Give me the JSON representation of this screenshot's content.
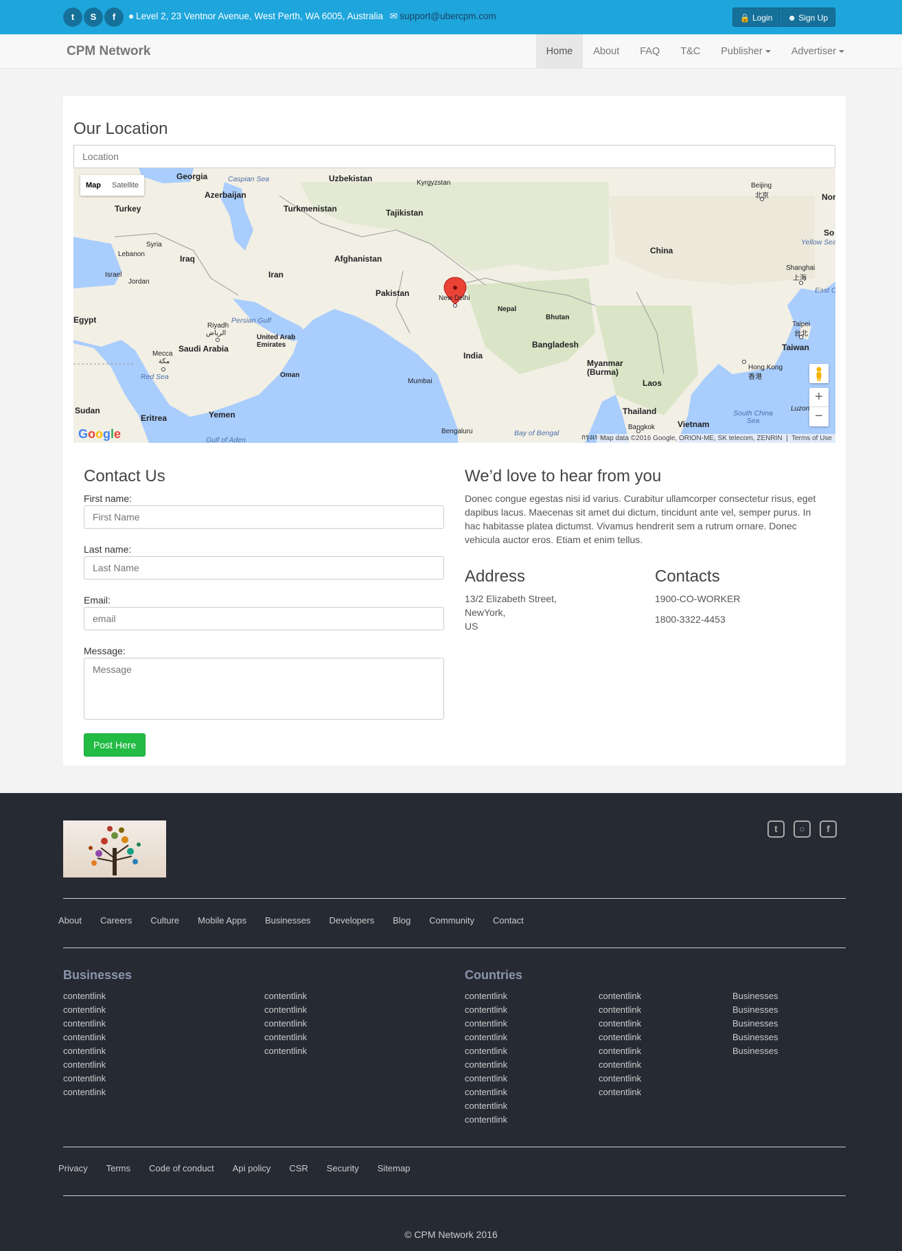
{
  "topbar": {
    "social": [
      "twitter-icon",
      "skype-icon",
      "facebook-icon"
    ],
    "address": "Level 2, 23 Ventnor Avenue, West Perth, WA 6005, Australia",
    "email": "support@ubercpm.com",
    "login": "Login",
    "signup": "Sign Up"
  },
  "navbar": {
    "brand": "CPM Network",
    "items": [
      "Home",
      "About",
      "FAQ",
      "T&C",
      "Publisher",
      "Advertiser"
    ]
  },
  "location": {
    "title": "Our Location",
    "placeholder": "Location"
  },
  "map": {
    "toggle_map": "Map",
    "toggle_satellite": "Satellite",
    "attribution": "Map data ©2016 Google, ORION-ME, SK telecom, ZENRIN",
    "terms": "Terms of Use",
    "google": "Google",
    "labels": {
      "georgia": "Georgia",
      "uzbekistan": "Uzbekistan",
      "kyrgyzstan": "Kyrgyzstan",
      "beijing": "Beijing",
      "beijing_cn": "北京",
      "north": "Nor",
      "azerbaijan": "Azerbaijan",
      "turkey": "Turkey",
      "turkmenistan": "Turkmenistan",
      "tajikistan": "Tajikistan",
      "syria": "Syria",
      "lebanon": "Lebanon",
      "iraq": "Iraq",
      "afghanistan": "Afghanistan",
      "china": "China",
      "yellow_sea": "Yellow Sea",
      "israel": "Israel",
      "jordan": "Jordan",
      "iran": "Iran",
      "pakistan": "Pakistan",
      "new_delhi": "New Delhi",
      "shanghai": "Shanghai",
      "shanghai_cn": "上海",
      "east_china": "East Ch",
      "egypt": "Egypt",
      "riyadh": "Riyadh",
      "riyadh_ar": "الرياض",
      "persian_gulf": "Persian Gulf",
      "nepal": "Nepal",
      "bhutan": "Bhutan",
      "taipei": "Taipei",
      "taipei_cn": "台北",
      "saudi_arabia": "Saudi Arabia",
      "uae": "United Arab Emirates",
      "bangladesh": "Bangladesh",
      "taiwan": "Taiwan",
      "mecca": "Mecca",
      "mecca_ar": "مكة",
      "india": "India",
      "red_sea": "Red Sea",
      "oman": "Oman",
      "myanmar": "Myanmar (Burma)",
      "hong_kong": "Hong Kong",
      "hong_kong_cn": "香港",
      "mumbai": "Mumbai",
      "laos": "Laos",
      "sudan": "Sudan",
      "eritrea": "Eritrea",
      "yemen": "Yemen",
      "thailand": "Thailand",
      "south_china_sea": "South China Sea",
      "luzon": "Luzon",
      "vietnam": "Vietnam",
      "bengaluru": "Bengaluru",
      "bay_of_bengal": "Bay of Bengal",
      "bangkok": "Bangkok",
      "gulf_of_aden": "Gulf of Aden",
      "caspian": "Caspian Sea",
      "so": "So",
      "bangkok_th": "กรุงเทพ"
    }
  },
  "contact": {
    "title": "Contact Us",
    "first_label": "First name:",
    "first_placeholder": "First Name",
    "last_label": "Last name:",
    "last_placeholder": "Last Name",
    "email_label": "Email:",
    "email_placeholder": "email",
    "message_label": "Message:",
    "message_placeholder": "Message",
    "submit": "Post Here"
  },
  "hear": {
    "title": "We’d love to hear from you",
    "text": "Donec congue egestas nisi id varius. Curabitur ullamcorper consectetur risus, eget dapibus lacus. Maecenas sit amet dui dictum, tincidunt ante vel, semper purus. In hac habitasse platea dictumst. Vivamus hendrerit sem a rutrum ornare. Donec vehicula auctor eros. Etiam et enim tellus."
  },
  "address": {
    "title": "Address",
    "lines": [
      "13/2 Elizabeth Street,",
      "NewYork,",
      "US"
    ]
  },
  "contacts": {
    "title": "Contacts",
    "phones": [
      "1900-CO-WORKER",
      "1800-3322-4453"
    ]
  },
  "footer": {
    "social": [
      "twitter-icon",
      "instagram-icon",
      "facebook-icon"
    ],
    "links": [
      "About",
      "Careers",
      "Culture",
      "Mobile Apps",
      "Businesses",
      "Developers",
      "Blog",
      "Community",
      "Contact"
    ],
    "businesses_title": "Businesses",
    "businesses_col1": [
      "contentlink",
      "contentlink",
      "contentlink",
      "contentlink",
      "contentlink",
      "contentlink",
      "contentlink",
      "contentlink"
    ],
    "businesses_col2": [
      "contentlink",
      "contentlink",
      "contentlink",
      "contentlink",
      "contentlink"
    ],
    "countries_title": "Countries",
    "countries_col1": [
      "contentlink",
      "contentlink",
      "contentlink",
      "contentlink",
      "contentlink",
      "contentlink",
      "contentlink",
      "contentlink",
      "contentlink",
      "contentlink"
    ],
    "countries_col2": [
      "contentlink",
      "contentlink",
      "contentlink",
      "contentlink",
      "contentlink",
      "contentlink",
      "contentlink",
      "contentlink"
    ],
    "countries_col3": [
      "Businesses",
      "Businesses",
      "Businesses",
      "Businesses",
      "Businesses"
    ],
    "bottom_links": [
      "Privacy",
      "Terms",
      "Code of conduct",
      "Api policy",
      "CSR",
      "Security",
      "Sitemap"
    ],
    "copyright": "© CPM Network 2016"
  },
  "colors": {
    "topbar": "#1ea6dc",
    "button_dark": "#16719a",
    "post_button": "#22bb44",
    "footer_bg": "#262a33",
    "footer_heading": "#8a95ae",
    "map_water": "#a9cdfd",
    "map_land": "#f2efe5"
  }
}
